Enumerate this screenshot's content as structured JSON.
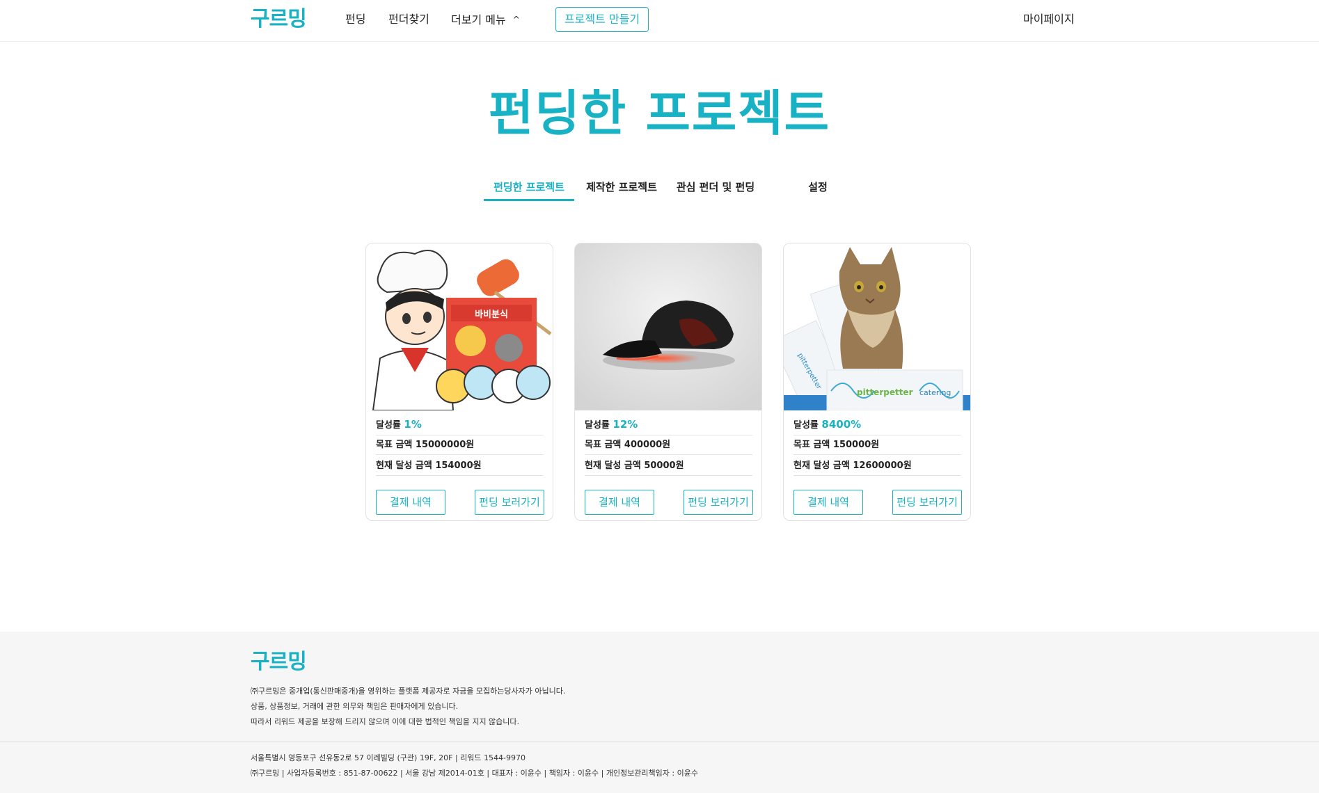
{
  "header": {
    "logo": "구르밍",
    "nav": [
      "펀딩",
      "펀더찾기",
      "더보기 메뉴"
    ],
    "more_chevron": "^",
    "create_button": "프로젝트 만들기",
    "mypage": "마이페이지"
  },
  "page_title": "펀딩한 프로젝트",
  "tabs": [
    {
      "label": "펀딩한 프로젝트",
      "active": true
    },
    {
      "label": "제작한 프로젝트",
      "active": false
    },
    {
      "label": "관심 펀더 및 펀딩",
      "active": false
    },
    {
      "label": "설정",
      "active": false
    }
  ],
  "labels": {
    "rate": "달성률",
    "goal": "목표 금액",
    "current": "현재 달성 금액",
    "payment_button": "결제 내역",
    "view_button": "펀딩 보러가기"
  },
  "cards": [
    {
      "image": "cartoon-chef-tteokbokki",
      "rate": "1%",
      "goal": "15000000원",
      "current": "154000원"
    },
    {
      "image": "black-cap-red-light",
      "rate": "12%",
      "goal": "400000원",
      "current": "50000원"
    },
    {
      "image": "cat-pitterpetter-catering",
      "rate": "8400%",
      "goal": "150000원",
      "current": "12600000원"
    }
  ],
  "card3_image_text": {
    "brand1": "pitterpetter",
    "brand2": "catering",
    "bubble": "바비분식"
  },
  "footer": {
    "logo": "구르밍",
    "notice1": "㈜구르밍은 중개업(통신판매중개)을 영위하는 플랫폼 제공자로 자금을 모집하는당사자가 아닙니다.",
    "notice2": "상품, 상품정보, 거래에 관한 의무와 책임은 판매자에게 있습니다.",
    "notice3": "따라서 리워드 제공을 보장해 드리지 않으며 이에 대한 법적인 책임을 지지 않습니다.",
    "address": "서울특별시 영등포구 선유동2로 57 이레빌딩 (구관) 19F, 20F | 리워드 1544-9970",
    "company": "㈜구르밍  |  사업자등록번호 : 851-87-00622  |  서울 강남 제2014-01호  |  대표자 : 이윤수  |  책임자 : 이윤수  |  개인정보관리책임자 : 이윤수"
  },
  "colors": {
    "accent": "#19b2c4",
    "footer_bg": "#f6f6f6"
  }
}
